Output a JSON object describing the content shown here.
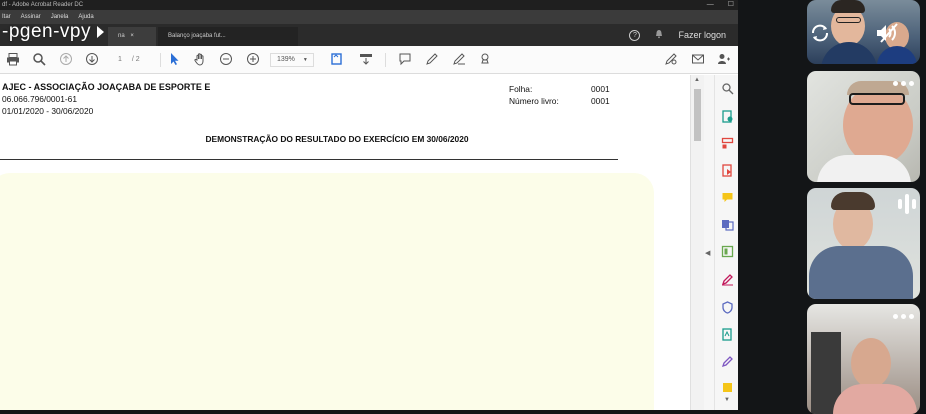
{
  "window": {
    "title": "df - Adobe Acrobat Reader DC",
    "menu": [
      "Itar",
      "Assinar",
      "Janela",
      "Ajuda"
    ]
  },
  "overlay": {
    "meeting_code": "-pgen-vpy"
  },
  "tabs": [
    {
      "label": "na",
      "close": "×"
    },
    {
      "label": "Balanço joaçaba fut..."
    }
  ],
  "tabbar_right": {
    "help": "?",
    "login": "Fazer logon"
  },
  "toolbar": {
    "page_current": "1",
    "page_total": "/ 2",
    "zoom": "139%"
  },
  "document": {
    "org_name": "AJEC - ASSOCIAÇÃO JOAÇABA  DE ESPORTE E",
    "cnpj": "06.066.796/0001-61",
    "period": "01/01/2020 - 30/06/2020",
    "folha_label": "Folha:",
    "folha_value": "0001",
    "livro_label": "Número livro:",
    "livro_value": "0001",
    "title": "DEMONSTRAÇÃO DO RESULTADO DO EXERCÍCIO EM 30/06/2020",
    "highlight_color": "#fcfde9"
  },
  "participants": [
    {
      "name": "participant-1",
      "muted": true
    },
    {
      "name": "participant-2"
    },
    {
      "name": "participant-3",
      "speaking": true
    },
    {
      "name": "participant-4"
    }
  ],
  "colors": {
    "accent_blue": "#2b6fd6",
    "strip_bg": "#131517"
  }
}
